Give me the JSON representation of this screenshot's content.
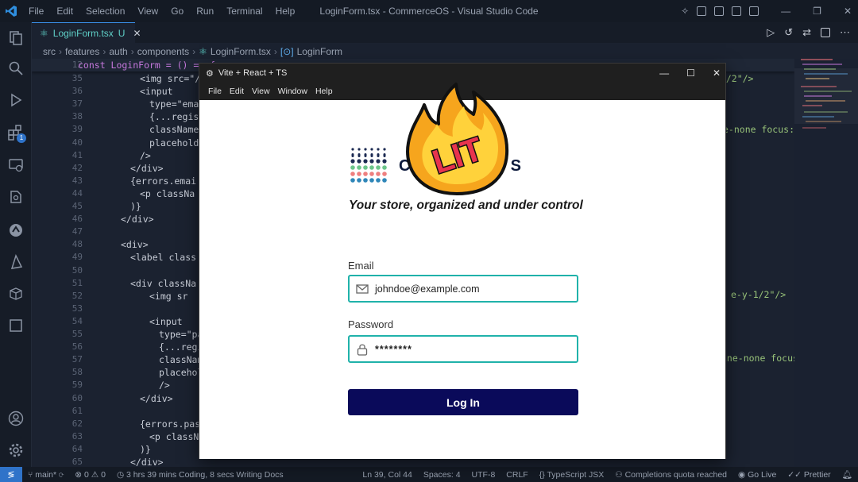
{
  "vscode": {
    "window_title": "LoginForm.tsx - CommerceOS - Visual Studio Code",
    "menu": [
      "File",
      "Edit",
      "Selection",
      "View",
      "Go",
      "Run",
      "Terminal",
      "Help"
    ],
    "tab": {
      "name": "LoginForm.tsx",
      "status": "U"
    },
    "breadcrumb": [
      "src",
      "features",
      "auth",
      "components",
      "LoginForm.tsx",
      "LoginForm"
    ],
    "activity_badge": "1",
    "sticky_line": {
      "num": "12",
      "text": "const LoginForm = () => {"
    },
    "lines": [
      {
        "num": "35",
        "text": "<img src=\"/"
      },
      {
        "num": "36",
        "text": "<input"
      },
      {
        "num": "37",
        "text": "type=\"emai"
      },
      {
        "num": "38",
        "text": "{...regist"
      },
      {
        "num": "39",
        "text": "className="
      },
      {
        "num": "40",
        "text": "placeholde"
      },
      {
        "num": "41",
        "text": "/>"
      },
      {
        "num": "42",
        "text": "</div>"
      },
      {
        "num": "43",
        "text": "{errors.emai"
      },
      {
        "num": "44",
        "text": "<p classNa"
      },
      {
        "num": "45",
        "text": ")}"
      },
      {
        "num": "46",
        "text": "</div>"
      },
      {
        "num": "47",
        "text": ""
      },
      {
        "num": "48",
        "text": "<div>"
      },
      {
        "num": "49",
        "text": "<label class"
      },
      {
        "num": "50",
        "text": ""
      },
      {
        "num": "51",
        "text": "<div classNa"
      },
      {
        "num": "52",
        "text": "<img sr"
      },
      {
        "num": "53",
        "text": ""
      },
      {
        "num": "54",
        "text": "<input"
      },
      {
        "num": "55",
        "text": "type=\"pa"
      },
      {
        "num": "56",
        "text": "{...regi"
      },
      {
        "num": "57",
        "text": "classNam"
      },
      {
        "num": "58",
        "text": "placehol"
      },
      {
        "num": "59",
        "text": "/>"
      },
      {
        "num": "60",
        "text": "</div>"
      },
      {
        "num": "61",
        "text": ""
      },
      {
        "num": "62",
        "text": "{errors.pass"
      },
      {
        "num": "63",
        "text": "<p classN"
      },
      {
        "num": "64",
        "text": ")}"
      },
      {
        "num": "65",
        "text": "</div>"
      }
    ],
    "right_fragments": {
      "r1": "-1/2\"/>",
      "r2": "e-none focus:r",
      "r3": "e-y-1/2\"/>",
      "r4": "ine-none focus"
    },
    "status": {
      "branch": "main*",
      "problems": "0",
      "warnings": "0",
      "time": "3 hrs 39 mins Coding, 8 secs Writing Docs",
      "cursor": "Ln 39, Col 44",
      "spaces": "Spaces: 4",
      "encoding": "UTF-8",
      "eol": "CRLF",
      "language": "TypeScript JSX",
      "quota": "Completions quota reached",
      "golive": "Go Live",
      "prettier": "Prettier"
    }
  },
  "app": {
    "window_title": "Vite + React + TS",
    "menu": [
      "File",
      "Edit",
      "View",
      "Window",
      "Help"
    ],
    "brand_prefix": "Co",
    "brand_suffix": "S",
    "sticker_text": "LIT",
    "tagline": "Your store, organized and under control",
    "email_label": "Email",
    "email_value": "johndoe@example.com",
    "password_label": "Password",
    "password_value": "********",
    "login_button": "Log In"
  }
}
